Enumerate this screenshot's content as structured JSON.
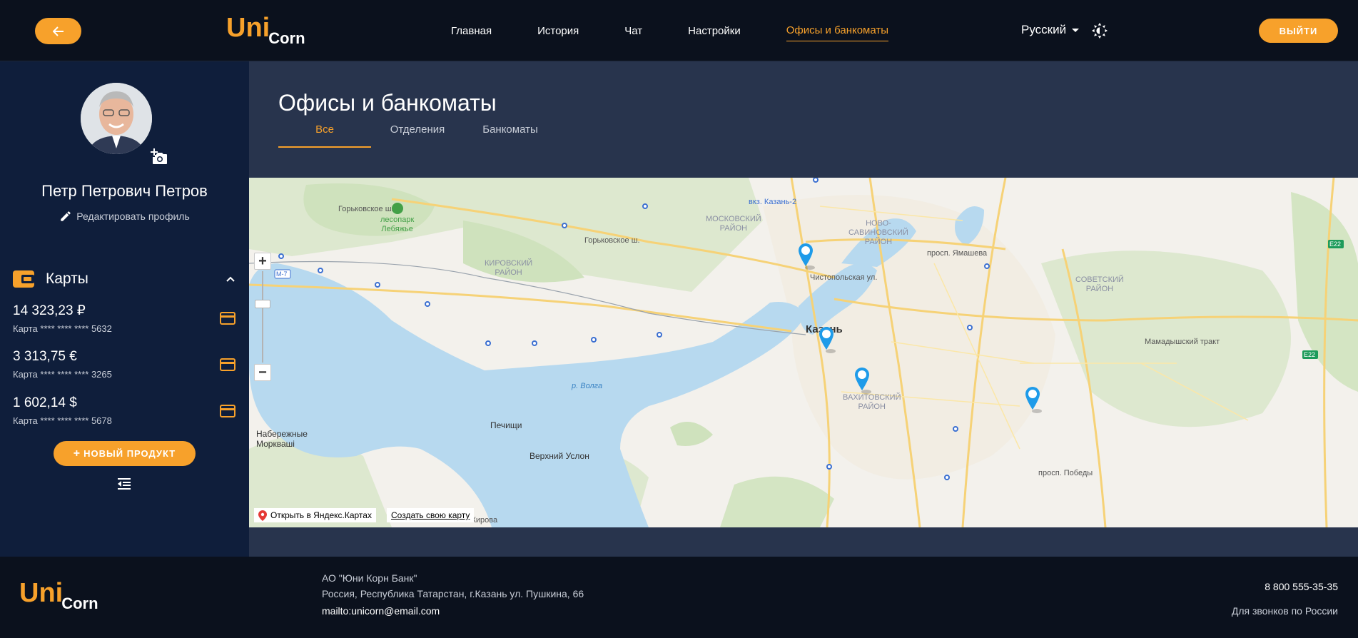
{
  "header": {
    "logo": {
      "uni": "Uni",
      "corn": "Corn"
    },
    "nav": [
      "Главная",
      "История",
      "Чат",
      "Настройки",
      "Офисы и банкоматы"
    ],
    "language": "Русский",
    "logout_label": "ВЫЙТИ"
  },
  "sidebar": {
    "user_name": "Петр Петрович Петров",
    "edit_profile": "Редактировать профиль",
    "cards_title": "Карты",
    "cards": [
      {
        "amount": "14 323,23 ₽",
        "number": "Карта **** **** **** 5632"
      },
      {
        "amount": "3 313,75 €",
        "number": "Карта **** **** **** 3265"
      },
      {
        "amount": "1 602,14 $",
        "number": "Карта **** **** **** 5678"
      }
    ],
    "new_product": "НОВЫЙ ПРОДУКТ"
  },
  "main": {
    "title": "Офисы и банкоматы",
    "tabs": [
      "Все",
      "Отделения",
      "Банкоматы"
    ]
  },
  "map": {
    "labels": {
      "lesopark": "лесопарк\nЛебяжье",
      "moskovsky": "МОСКОВСКИЙ\nРАЙОН",
      "novosavinovsky": "НОВО-\nСАВИНОВСКИЙ\nРАЙОН",
      "kirovsky": "КИРОВСКИЙ\nРАЙОН",
      "sovetsky": "СОВЕТСКИЙ\nРАЙОН",
      "vakhitovsky": "ВАХИТОВСКИЙ\nРАЙОН",
      "kazan": "Казань",
      "station": "вкз. Казань-2",
      "naberezhnye": "Набережные\nМорквашi",
      "pechishchi": "Печищи",
      "verkhny_uslon": "Верхний Услон",
      "volga": "р. Волга",
      "gorkovskoe1": "Горьковское ш.",
      "gorkovskoe2": "Горьковское ш.",
      "mamadysh": "Мамадышский тракт",
      "yamasheva": "просп. Ямашева",
      "pobedy": "просп. Победы",
      "kirova": "пос. им. Кирова",
      "chistopolskaya": "Чистопольская ул.",
      "m7": "М-7",
      "e22a": "E22",
      "e22b": "E22"
    },
    "open_in": "Открыть в Яндекс.Картах",
    "create_map": "Создать свою карту",
    "pin_color": "#1e9be9"
  },
  "footer": {
    "logo": {
      "uni": "Uni",
      "corn": "Corn"
    },
    "org": "АО \"Юни Корн Банк\"",
    "address": "Россия, Республика Татарстан, г.Казань ул. Пушкина, 66",
    "email": "mailto:unicorn@email.com",
    "phone": "8 800 555-35-35",
    "phone_note": "Для звонков по России"
  }
}
